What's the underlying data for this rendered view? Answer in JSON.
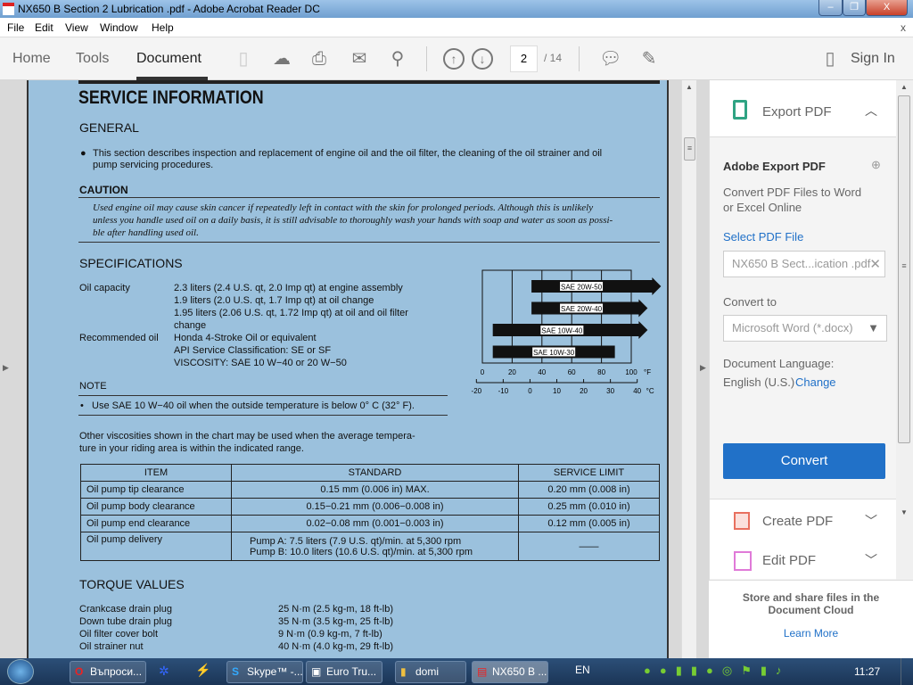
{
  "window": {
    "title": "NX650 B Section 2 Lubrication .pdf - Adobe Acrobat Reader DC",
    "minimize": "–",
    "restore": "❐",
    "close": "X"
  },
  "menu": [
    "File",
    "Edit",
    "View",
    "Window",
    "Help"
  ],
  "menu_close": "x",
  "toolbar": {
    "tabs": [
      "Home",
      "Tools",
      "Document"
    ],
    "page_current": "2",
    "page_total": "/ 14",
    "sign_in": "Sign In"
  },
  "doc": {
    "title": "SERVICE INFORMATION",
    "general_heading": "GENERAL",
    "general_1": "This section describes inspection and replacement of engine oil and the oil filter, the cleaning of the oil strainer and oil",
    "general_2": "pump servicing procedures.",
    "caution_heading": "CAUTION",
    "caution_1": "Used engine oil may cause skin cancer if repeatedly left in contact with the skin for prolonged periods. Although this is unlikely",
    "caution_2": "unless you handle used oil on a daily basis, it is still advisable to thoroughly wash your hands with soap and water as soon as possi-",
    "caution_3": "ble after handling used oil.",
    "spec_heading": "SPECIFICATIONS",
    "oil_capacity_label": "Oil capacity",
    "oil_capacity": [
      "2.3 liters (2.4 U.S. qt, 2.0 Imp qt) at engine assembly",
      "1.9 liters (2.0 U.S. qt, 1.7 Imp qt) at oil change",
      "1.95 liters (2.06 U.S. qt, 1.72 Imp qt) at oil and oil filter",
      "change"
    ],
    "rec_oil_label": "Recommended oil",
    "rec_oil": [
      "Honda 4-Stroke Oil or equivalent",
      "API Service Classification: SE or SF",
      "VISCOSITY: SAE 10 W−40 or 20 W−50"
    ],
    "note_heading": "NOTE",
    "note_1": "Use SAE 10 W−40 oil when the outside temperature is below 0° C (32° F).",
    "other_1": "Other viscosities shown in the chart may be used when the average tempera-",
    "other_2": "ture in your riding area is within the indicated range.",
    "table": {
      "headers": [
        "ITEM",
        "STANDARD",
        "SERVICE LIMIT"
      ],
      "rows": [
        [
          "Oil pump tip clearance",
          "0.15 mm (0.006 in) MAX.",
          "0.20 mm (0.008 in)"
        ],
        [
          "Oil pump body clearance",
          "0.15−0.21 mm (0.006−0.008 in)",
          "0.25 mm (0.010 in)"
        ],
        [
          "Oil pump end clearance",
          "0.02−0.08 mm (0.001−0.003 in)",
          "0.12 mm (0.005 in)"
        ],
        [
          "Oil pump delivery",
          "Pump A: 7.5 liters (7.9 U.S. qt)/min. at 5,300 rpm",
          "——"
        ]
      ],
      "delivery_b": "Pump B: 10.0 liters (10.6 U.S. qt)/min. at 5,300 rpm"
    },
    "torque_heading": "TORQUE VALUES",
    "torque": [
      [
        "Crankcase drain plug",
        "25 N·m (2.5 kg-m, 18 ft-lb)"
      ],
      [
        "Down tube drain plug",
        "35 N·m (3.5 kg-m, 25 ft-lb)"
      ],
      [
        "Oil filter cover bolt",
        "9 N·m (0.9 kg-m, 7 ft-lb)"
      ],
      [
        "Oil strainer nut",
        "40 N·m (4.0 kg-m, 29 ft-lb)"
      ]
    ]
  },
  "chart_data": {
    "type": "bar",
    "orientation": "horizontal",
    "title": "",
    "xlabel": "°F",
    "x2label": "°C",
    "categories": [
      "SAE 20W-50",
      "SAE 20W-40",
      "SAE 10W-40",
      "SAE 10W-30"
    ],
    "ranges": [
      [
        33,
        120
      ],
      [
        33,
        111
      ],
      [
        7,
        111
      ],
      [
        7,
        89
      ]
    ],
    "arrow": [
      true,
      true,
      true,
      false
    ],
    "xlim": [
      0,
      100
    ],
    "xticks": [
      0,
      20,
      40,
      60,
      80,
      100
    ],
    "x2ticks": [
      -20,
      -10,
      0,
      10,
      20,
      30,
      40
    ]
  },
  "panel": {
    "export_title": "Export PDF",
    "adobe_export": "Adobe Export PDF",
    "desc_1": "Convert PDF Files to Word",
    "desc_2": "or Excel Online",
    "select_file": "Select PDF File",
    "file_value": "NX650 B Sect...ication .pdf",
    "convert_to": "Convert to",
    "format_value": "Microsoft Word (*.docx)",
    "doc_lang": "Document Language:",
    "lang_value": "English (U.S.)",
    "change": "Change",
    "convert": "Convert",
    "create_pdf": "Create PDF",
    "edit_pdf": "Edit PDF",
    "cloud_1": "Store and share files in the",
    "cloud_2": "Document Cloud",
    "learn_more": "Learn More"
  },
  "taskbar": {
    "items": [
      "Въпроси...",
      "Skype™ -...",
      "Euro Tru...",
      "domi",
      "NX650 B ..."
    ],
    "lang": "EN",
    "clock": "11:27"
  },
  "colors": {
    "page": "#9bc1dd",
    "accent": "#2171c8",
    "export": "#2fa383"
  }
}
